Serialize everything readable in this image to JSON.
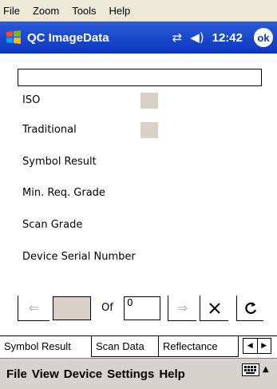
{
  "host_menu": [
    "File",
    "Zoom",
    "Tools",
    "Help"
  ],
  "titlebar": {
    "title": "QC ImageData",
    "time": "12:42",
    "ok": "ok"
  },
  "labels": {
    "iso": "ISO",
    "traditional": "Traditional",
    "symbol_result": "Symbol Result",
    "min_req": "Min. Req. Grade",
    "scan_grade": "Scan Grade",
    "device_serial": "Device Serial Number"
  },
  "nav": {
    "of": "Of",
    "total": "0"
  },
  "tabs": [
    "Symbol Result",
    "Scan Data",
    "Reflectance"
  ],
  "bottom_menu": [
    "File",
    "View",
    "Device",
    "Settings",
    "Help"
  ]
}
